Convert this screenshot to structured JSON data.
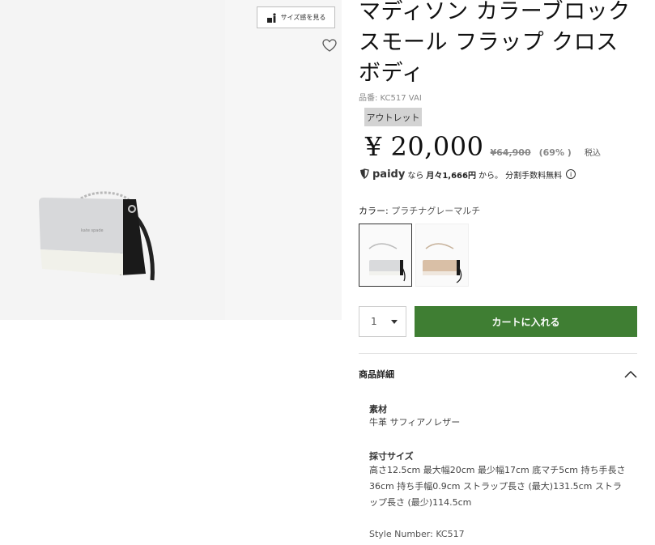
{
  "gallery": {
    "size_button_label": "サイズ感を見る"
  },
  "product": {
    "title": "マディソン カラーブロック スモール フラップ クロスボディ",
    "code": "品番: KC517 VAI",
    "badge": "アウトレット",
    "price": "¥ 20,000",
    "original_price": "¥64,900",
    "discount": "(69% )",
    "tax_label": "税込",
    "paidy": {
      "logo": "paidy",
      "text_prefix": "なら",
      "text_bold": "月々1,666円",
      "text_suffix": "から。 分割手数料無料",
      "info_icon": "i"
    },
    "color_label": "カラー:",
    "color_value": "プラチナグレーマルチ",
    "swatches": [
      "platinum-grey-multi",
      "beige-multi"
    ],
    "quantity": "1",
    "cart_button": "カートに入れる"
  },
  "details": {
    "heading": "商品詳細",
    "material_heading": "素材",
    "material_value": "牛革 サフィアノレザー",
    "size_heading": "採寸サイズ",
    "size_value": "高さ12.5cm 最大幅20cm 最少幅17cm 底マチ5cm 持ち手長さ36cm 持ち手幅0.9cm ストラップ長さ (最大)131.5cm ストラップ長さ (最少)114.5cm",
    "style_number": "Style Number:  KC517"
  },
  "colors": {
    "cart_green": "#3f7e33",
    "badge_grey": "#d3d3d3"
  }
}
